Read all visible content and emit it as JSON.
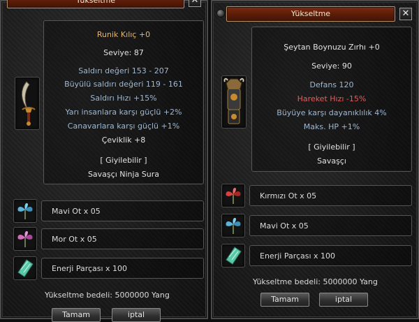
{
  "left": {
    "title": "Yükseltme",
    "close": "✕",
    "item_name": "Runik Kılıç +0",
    "level": "Seviye: 87",
    "stats": [
      "Saldırı değeri 153 - 207",
      "Büyülü saldırı değeri 119 - 161",
      "Saldırı Hızı +15%",
      "Yarı insanlara karşı güçlü +2%",
      "Canavarlara karşı güçlü +1%",
      "Çeviklik +8"
    ],
    "wearable": "[ Giyilebilir ]",
    "classes": "Savaşçı Ninja Sura",
    "materials": [
      "Mavi Ot x 05",
      "Mor Ot x 05",
      "Enerji Parçası x 100"
    ],
    "cost": "Yükseltme bedeli: 5000000 Yang",
    "ok_label": "Tamam",
    "cancel_label": "iptal"
  },
  "right": {
    "title": "Yükseltme",
    "close": "✕",
    "item_name": "Şeytan Boynuzu Zırhı +0",
    "level": "Seviye: 90",
    "stats": [
      "Defans 120",
      "Hareket Hızı -15%",
      "Büyüye karşı dayanıklılık 4%",
      "Maks. HP +1%"
    ],
    "wearable": "[ Giyilebilir ]",
    "classes": "Savaşçı",
    "materials": [
      "Kırmızı Ot x 05",
      "Mavi Ot x 05",
      "Enerji Parçası x 100"
    ],
    "cost": "Yükseltme bedeli: 5000000 Yang",
    "ok_label": "Tamam",
    "cancel_label": "iptal"
  },
  "colors": {
    "title_bar": "#5a1c08",
    "stat_blue": "#9fb8d2",
    "item_gold": "#e6b771",
    "negative_red": "#e55c5c"
  },
  "icons": {
    "left_equipment": "curved-sword-icon",
    "right_equipment": "demon-horn-armor-icon",
    "blue_herb": "blue-herb-icon",
    "purple_herb": "purple-herb-icon",
    "red_herb": "red-herb-icon",
    "energy_shard": "energy-shard-icon"
  }
}
